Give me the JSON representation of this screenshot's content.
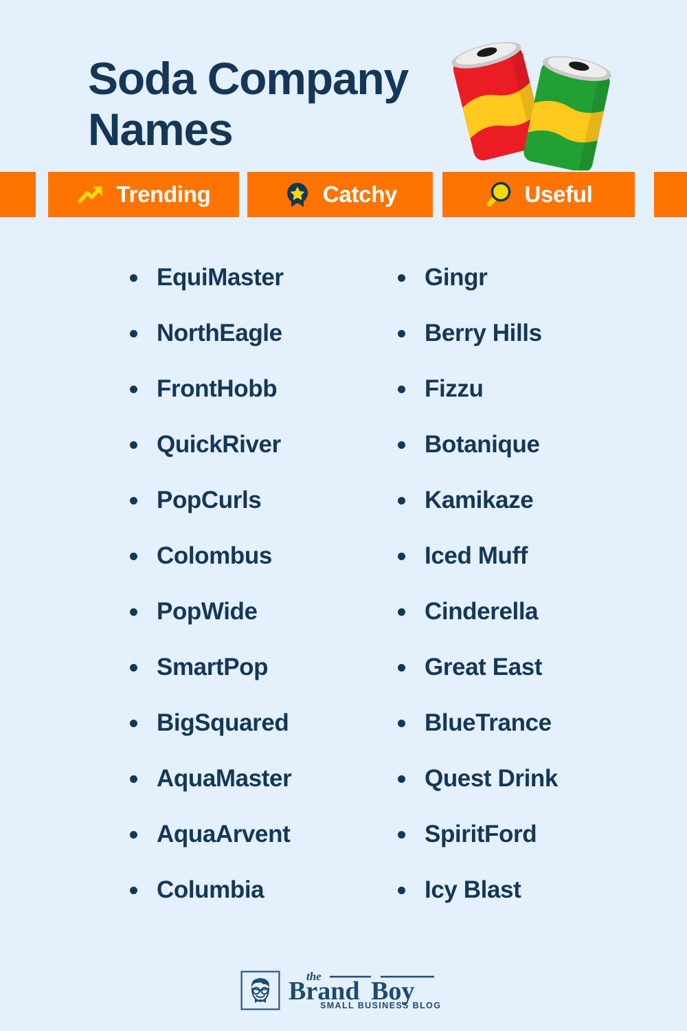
{
  "theme": {
    "background": "#e4f0fc",
    "navy": "#143757",
    "orange": "#ff7300",
    "yellow": "#f5d90a",
    "white": "#ffffff",
    "can_red": "#ec1c24",
    "can_green": "#22a034",
    "can_yellow": "#ffc91d",
    "can_metal": "#d9d9d9"
  },
  "header": {
    "title": "Soda Company Names",
    "artwork": "soda-cans-illustration"
  },
  "badges": [
    {
      "label": "Trending",
      "icon": "trending-up-icon"
    },
    {
      "label": "Catchy",
      "icon": "award-ribbon-star-icon"
    },
    {
      "label": "Useful",
      "icon": "magnifying-glass-icon"
    }
  ],
  "columns": [
    {
      "names": [
        "EquiMaster",
        "NorthEagle",
        "FrontHobb",
        "QuickRiver",
        "PopCurls",
        "Colombus",
        "PopWide",
        "SmartPop",
        "BigSquared",
        "AquaMaster",
        "AquaArvent",
        "Columbia"
      ]
    },
    {
      "names": [
        "Gingr",
        "Berry Hills",
        "Fizzu",
        "Botanique",
        "Kamikaze",
        "Iced Muff",
        "Cinderella",
        "Great East",
        "BlueTrance",
        "Quest Drink",
        "SpiritFord",
        "Icy Blast"
      ]
    }
  ],
  "footer": {
    "logo": {
      "mark": "brandboy-face-icon",
      "the": "the",
      "brand": "Brand",
      "boy": "Boy",
      "tagline": "SMALL BUSINESS BLOG"
    }
  }
}
